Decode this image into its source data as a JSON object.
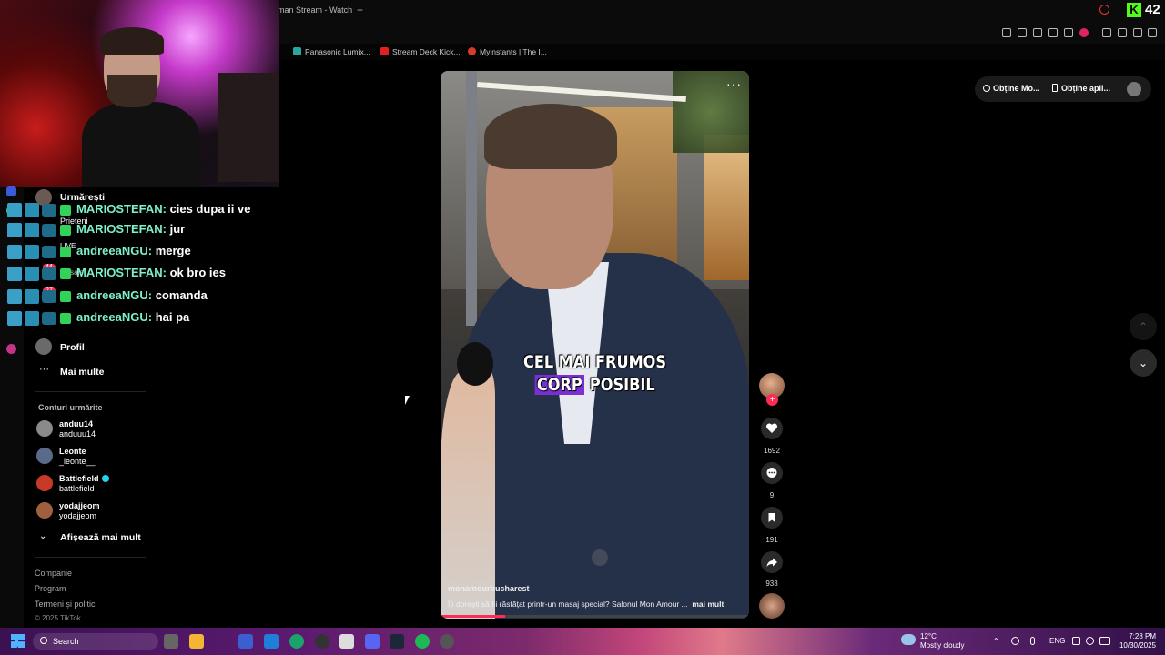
{
  "browser": {
    "tab_title": "man Stream - Watch",
    "new_tab": "+",
    "kick_logo": "K",
    "kick_count": "42",
    "bookmarks": [
      {
        "label": "Panasonic Lumix...",
        "color": "#2aa5a0"
      },
      {
        "label": "Stream Deck Kick...",
        "color": "#e22020"
      },
      {
        "label": "Myinstants | The I...",
        "color": "#d83a2c"
      }
    ]
  },
  "sidebar": {
    "nav": {
      "following": "Urmărești",
      "friends": "Prieteni",
      "live": "LIVE",
      "messages": "Mesaje",
      "profile": "Profil",
      "more": "Mai multe"
    },
    "badges": {
      "messages": "44",
      "activity": "27"
    },
    "followed_header": "Conturi urmărite",
    "followed": [
      {
        "name": "anduu14",
        "handle": "anduuu14",
        "color": "#8a8a8a"
      },
      {
        "name": "Leonte",
        "handle": "_leonte__",
        "color": "#5a6a8a"
      },
      {
        "name": "Battlefield",
        "handle": "battlefield",
        "color": "#c73a2a",
        "verified": true
      },
      {
        "name": "yodajjeom",
        "handle": "yodajjeom",
        "color": "#a06040"
      }
    ],
    "show_more": "Afișează mai mult",
    "footer": {
      "company": "Companie",
      "program": "Program",
      "terms": "Termeni și politici",
      "copyright": "© 2025 TikTok"
    }
  },
  "chat": [
    {
      "user": "MARIOSTEFAN:",
      "message": "cies dupa ii ve"
    },
    {
      "user": "MARIOSTEFAN:",
      "message": "jur"
    },
    {
      "user": "andreeaNGU:",
      "message": "merge"
    },
    {
      "user": "MARIOSTEFAN:",
      "message": "ok bro ies"
    },
    {
      "user": "andreeaNGU:",
      "message": "comanda"
    },
    {
      "user": "andreeaNGU:",
      "message": "hai pa"
    }
  ],
  "video": {
    "more_menu": "···",
    "caption_line1": "CEL MAI FRUMOS",
    "caption_highlight": "CORP",
    "caption_rest": "POSIBIL",
    "author": "monamourbucharest",
    "description": "Îți dorești să fii răsfățat printr-un masaj special? Salonul Mon Amour ...",
    "more_label": "mai mult",
    "progress": 0.21
  },
  "actions": {
    "follow_plus": "+",
    "likes": "1692",
    "comments": "9",
    "saves": "191",
    "shares": "933"
  },
  "top_right": {
    "get_coins": "Obține Mo...",
    "get_app": "Obține apli..."
  },
  "navigation": {
    "up": "⌃",
    "down": "⌄"
  },
  "taskbar": {
    "search": "Search",
    "weather_temp": "12°C",
    "weather_desc": "Mostly cloudy",
    "language": "ENG",
    "time": "7:28 PM",
    "date": "10/30/2025"
  },
  "colors": {
    "accent": "#fe2c55",
    "caption_highlight": "#7b2fd4",
    "chat_user": "#7cf0c8",
    "kick_green": "#53fc18"
  }
}
